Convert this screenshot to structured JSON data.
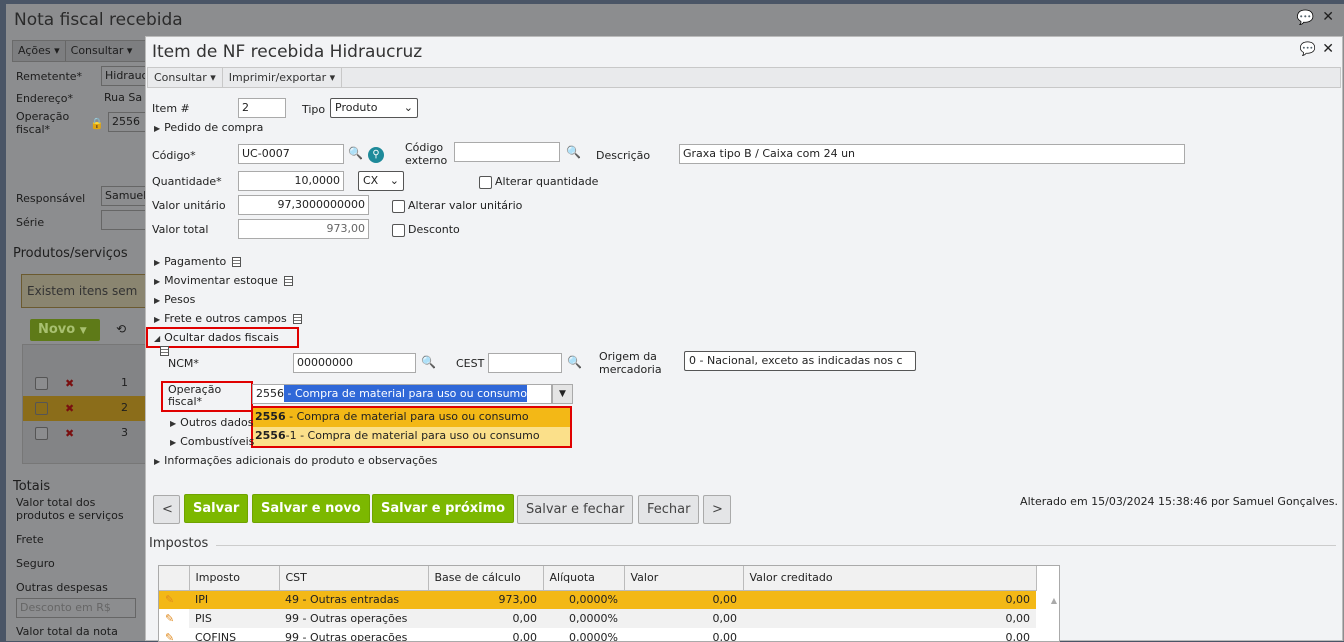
{
  "background": {
    "title": "Nota fiscal recebida",
    "toolbar": [
      "Ações",
      "Consultar"
    ],
    "remetente_label": "Remetente*",
    "remetente_value": "Hidrauc",
    "endereco_label": "Endereço*",
    "endereco_value": "Rua Sa",
    "operacao_label": "Operação fiscal*",
    "operacao_value": "2556",
    "responsavel_label": "Responsável",
    "responsavel_value": "Samuel",
    "serie_label": "Série",
    "produtos_title": "Produtos/serviços",
    "warning": "Existem itens sem",
    "novo_label": "Novo",
    "rows": [
      "1",
      "2",
      "3"
    ],
    "totais_title": "Totais",
    "totais": [
      "Valor total dos produtos e serviços",
      "Frete",
      "Seguro",
      "Outras despesas"
    ],
    "desconto_select": "Desconto em R$",
    "valor_total_nota": "Valor total da nota"
  },
  "modal": {
    "title": "Item de NF recebida Hidraucruz",
    "toolbar": [
      "Consultar",
      "Imprimir/exportar"
    ],
    "item_label": "Item #",
    "item_value": "2",
    "tipo_label": "Tipo",
    "tipo_value": "Produto",
    "pedido": "Pedido de compra",
    "codigo_label": "Código*",
    "codigo_value": "UC-0007",
    "codigo_externo_label": "Código externo",
    "codigo_externo_value": "",
    "descricao_label": "Descrição",
    "descricao_value": "Graxa tipo B / Caixa com 24 un",
    "quantidade_label": "Quantidade*",
    "quantidade_value": "10,0000",
    "unidade": "CX",
    "alterar_quantidade": "Alterar quantidade",
    "valor_unitario_label": "Valor unitário",
    "valor_unitario_value": "97,3000000000",
    "alterar_valor_unitario": "Alterar valor unitário",
    "valor_total_label": "Valor total",
    "valor_total_value": "973,00",
    "desconto": "Desconto",
    "sections": [
      "Pagamento",
      "Movimentar estoque",
      "Pesos",
      "Frete e outros campos",
      "Ocultar dados fiscais"
    ],
    "ncm_label": "NCM*",
    "ncm_value": "00000000",
    "cest_label": "CEST",
    "cest_value": "",
    "origem_label": "Origem da mercadoria",
    "origem_value": "0 - Nacional, exceto as indicadas nos c",
    "operacao_label": "Operação fiscal*",
    "operacao_typed": "2556",
    "operacao_selected": " - Compra de material para uso ou consumo",
    "options": [
      {
        "code": "2556",
        "rest": " - Compra de material para uso ou consumo"
      },
      {
        "code": "2556",
        "rest": "-1 - Compra de material para uso ou consumo"
      }
    ],
    "outros_dados": "Outros dados",
    "combustiveis": "Combustíveis",
    "info_adicionais": "Informações adicionais do produto e observações",
    "buttons": {
      "prev": "<",
      "salvar": "Salvar",
      "salvar_novo": "Salvar e novo",
      "salvar_proximo": "Salvar e próximo",
      "salvar_fechar": "Salvar e fechar",
      "fechar": "Fechar",
      "next": ">"
    },
    "alterado": "Alterado em 15/03/2024 15:38:46 por Samuel Gonçalves.",
    "impostos_title": "Impostos",
    "impostos_headers": [
      "Imposto",
      "CST",
      "Base de cálculo",
      "Alíquota",
      "Valor",
      "Valor creditado"
    ],
    "impostos_rows": [
      [
        "IPI",
        "49 - Outras entradas",
        "973,00",
        "0,0000%",
        "0,00",
        "0,00"
      ],
      [
        "PIS",
        "99 - Outras operações",
        "0,00",
        "0,0000%",
        "0,00",
        "0,00"
      ],
      [
        "COFINS",
        "99 - Outras operações",
        "0,00",
        "0,0000%",
        "0,00",
        "0,00"
      ]
    ]
  }
}
